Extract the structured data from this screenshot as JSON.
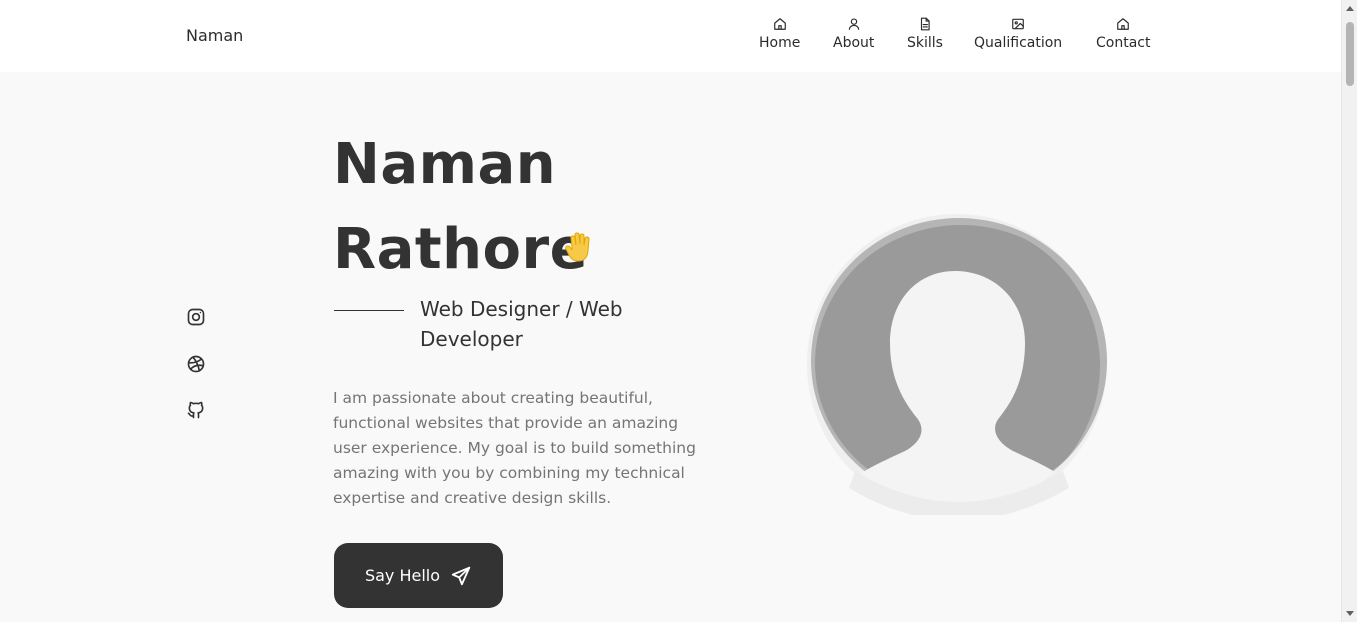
{
  "header": {
    "logo": "Naman",
    "nav": [
      {
        "label": "Home",
        "icon": "home-icon"
      },
      {
        "label": "About",
        "icon": "user-icon"
      },
      {
        "label": "Skills",
        "icon": "file-icon"
      },
      {
        "label": "Qualification",
        "icon": "image-icon"
      },
      {
        "label": "Contact",
        "icon": "home-icon"
      }
    ]
  },
  "social": [
    {
      "icon": "instagram-icon"
    },
    {
      "icon": "dribbble-icon"
    },
    {
      "icon": "github-icon"
    }
  ],
  "hero": {
    "first_name": "Naman",
    "last_name": "Rathore",
    "wave_icon": "waving-hand-icon",
    "subtitle": "Web Designer / Web Developer",
    "description": "I am passionate about creating beautiful, functional websites that provide an amazing user experience. My goal is to build something amazing with you by combining my technical expertise and creative design skills.",
    "cta_label": "Say Hello",
    "cta_icon": "send-icon"
  },
  "colors": {
    "background": "#f9f9f9",
    "text_dark": "#333333",
    "text_muted": "#757575",
    "button_bg": "#333333",
    "avatar_gray": "#9a9a9a"
  }
}
